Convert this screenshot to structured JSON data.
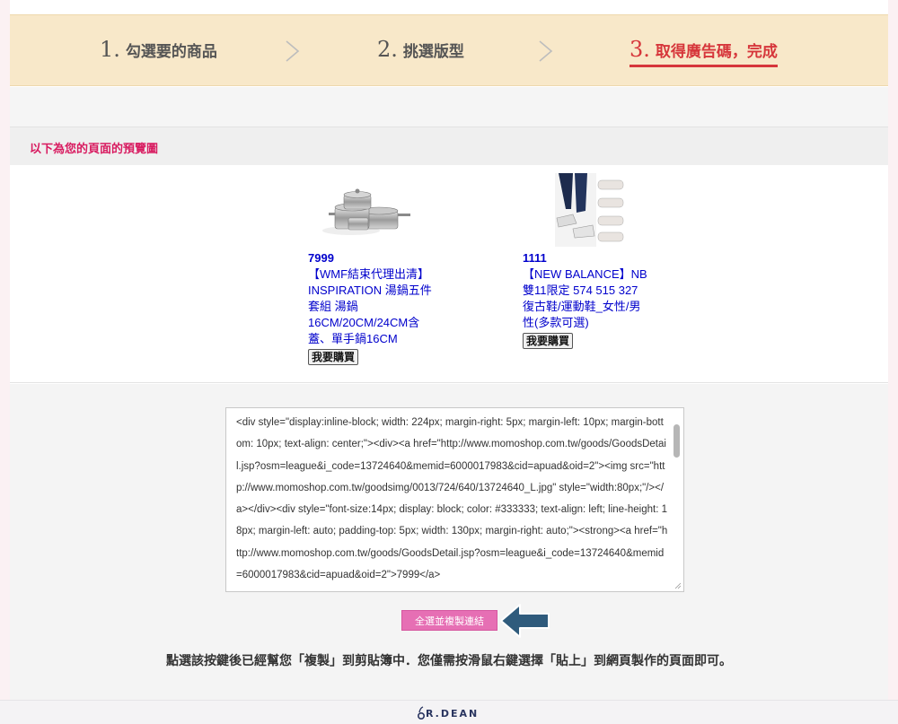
{
  "steps": [
    {
      "num": "1.",
      "label": "勾選要的商品"
    },
    {
      "num": "2.",
      "label": "挑選版型"
    },
    {
      "num": "3.",
      "label": "取得廣告碼，完成"
    }
  ],
  "preview": {
    "title": "以下為您的頁面的預覽圖"
  },
  "products": [
    {
      "price": "7999",
      "name": "【WMF結束代理出清】INSPIRATION 湯鍋五件套組 湯鍋16CM/20CM/24CM含蓋、單手鍋16CM",
      "buy_label": "我要購買",
      "image_icon": "cookware-set-image"
    },
    {
      "price": "1111",
      "name": "【NEW BALANCE】NB 雙11限定 574 515 327 復古鞋/運動鞋_女性/男性(多款可選)",
      "buy_label": "我要購買",
      "image_icon": "sneakers-image"
    }
  ],
  "code": {
    "value": "<div style=\"display:inline-block; width: 224px; margin-right: 5px; margin-left: 10px; margin-bottom: 10px; text-align: center;\"><div><a href=\"http://www.momoshop.com.tw/goods/GoodsDetail.jsp?osm=league&i_code=13724640&memid=6000017983&cid=apuad&oid=2\"><img src=\"http://www.momoshop.com.tw/goodsimg/0013/724/640/13724640_L.jpg\" style=\"width:80px;\"/></a></div><div style=\"font-size:14px; display: block; color: #333333; text-align: left; line-height: 18px; margin-left: auto; padding-top: 5px; width: 130px; margin-right: auto;\"><strong><a href=\"http://www.momoshop.com.tw/goods/GoodsDetail.jsp?osm=league&i_code=13724640&memid=6000017983&cid=apuad&oid=2\">7999</a>"
  },
  "copy_button": {
    "label": "全選並複製連結"
  },
  "instruction": "點選該按鍵後已經幫您「複製」到剪貼簿中．您僅需按滑鼠右鍵選擇「貼上」到網頁製作的頁面即可。",
  "footer": {
    "logo": "R.DEAN"
  },
  "colors": {
    "steps_bg": "#f8e8c9",
    "active_step": "#d6363b",
    "preview_title": "#d81b60",
    "product_link": "#0000cc",
    "copy_button": "#e66fb4",
    "arrow": "#2f5b7c"
  }
}
